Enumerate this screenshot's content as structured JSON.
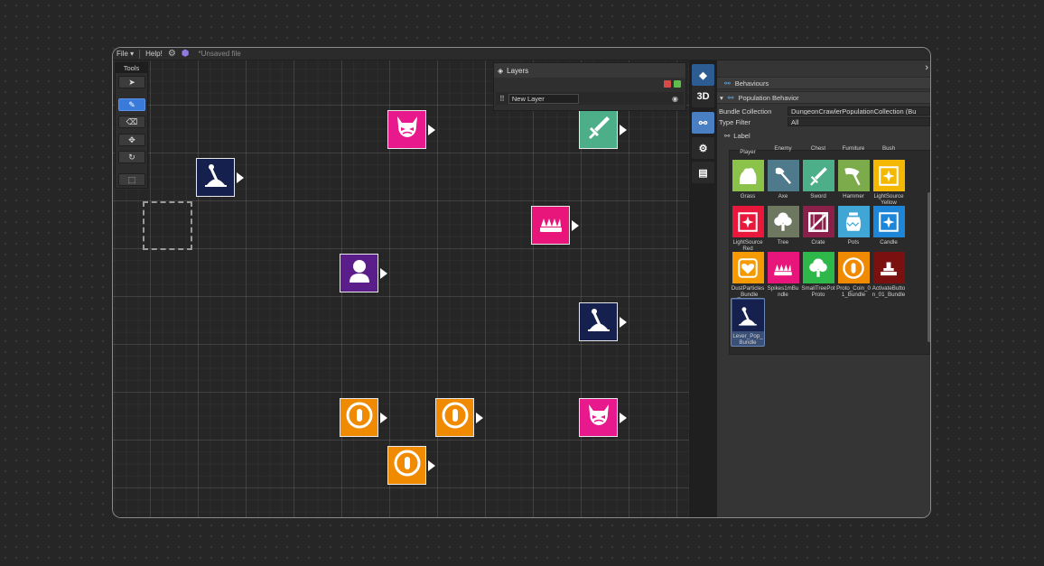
{
  "menu": {
    "file": "File ▾",
    "help": "Help!",
    "unsaved": "*Unsaved file"
  },
  "tools": {
    "title": "Tools"
  },
  "layers": {
    "title": "Layers",
    "layer_name": "New Layer"
  },
  "iconbar": {
    "label_3d": "3D"
  },
  "inspector": {
    "behaviours": "Behaviours",
    "population_behavior": "Population Behavior",
    "bundle_collection_label": "Bundle Collection",
    "bundle_collection_value": "DungeonCrawlerPopulationCollection (Bu",
    "type_filter_label": "Type Filter",
    "type_filter_value": "All",
    "label_header": "Label"
  },
  "palette": {
    "top_labels": [
      "Player",
      "Enemy",
      "Chest",
      "Furniture",
      "Bush"
    ],
    "items": [
      {
        "label": "Grass",
        "color": "#8bc34a",
        "icon": "grass-icon"
      },
      {
        "label": "Axe",
        "color": "#4f7a8c",
        "icon": "axe-icon"
      },
      {
        "label": "Sword",
        "color": "#4caf8a",
        "icon": "sword-icon"
      },
      {
        "label": "Hammer",
        "color": "#7cab4b",
        "icon": "hammer-icon"
      },
      {
        "label": "LightSource Yellow",
        "color": "#f5b800",
        "icon": "light-icon"
      },
      {
        "label": "LightSource Red",
        "color": "#e8173b",
        "icon": "light-icon"
      },
      {
        "label": "Tree",
        "color": "#6e7860",
        "icon": "tree-icon"
      },
      {
        "label": "Crate",
        "color": "#8a1f4a",
        "icon": "crate-icon"
      },
      {
        "label": "Pots",
        "color": "#3fa6d6",
        "icon": "pot-icon"
      },
      {
        "label": "Candle",
        "color": "#1e86d8",
        "icon": "light-icon"
      },
      {
        "label": "DustParticles_Bundle",
        "color": "#f59a00",
        "icon": "heart-icon"
      },
      {
        "label": "Spikes1mBundle",
        "color": "#e8167a",
        "icon": "spikes-icon"
      },
      {
        "label": "SmallTreePotProto",
        "color": "#2fb84a",
        "icon": "tree-icon"
      },
      {
        "label": "Proto_Coin_01_Bundle",
        "color": "#f08a00",
        "icon": "coin-icon"
      },
      {
        "label": "ActivateButton_01_Bundle",
        "color": "#7a1010",
        "icon": "button-icon"
      },
      {
        "label": "Lever_Pop_Bundle",
        "color": "#15204f",
        "icon": "lever-icon"
      }
    ]
  },
  "canvas_tiles": [
    {
      "name": "enemy-tile",
      "color": "#e8198c",
      "icon": "demon-icon"
    },
    {
      "name": "sword-tile",
      "color": "#4caf8a",
      "icon": "sword-icon"
    },
    {
      "name": "lever-tile",
      "color": "#15204f",
      "icon": "lever-icon"
    },
    {
      "name": "spikes-tile",
      "color": "#e8167a",
      "icon": "spikes-icon"
    },
    {
      "name": "player-tile",
      "color": "#5a1d8a",
      "icon": "player-icon"
    },
    {
      "name": "lever-tile",
      "color": "#15204f",
      "icon": "lever-icon"
    },
    {
      "name": "coin-tile",
      "color": "#f08a00",
      "icon": "coin-icon"
    },
    {
      "name": "coin-tile",
      "color": "#f08a00",
      "icon": "coin-icon"
    },
    {
      "name": "enemy-tile",
      "color": "#e8198c",
      "icon": "demon-icon"
    },
    {
      "name": "coin-tile",
      "color": "#f08a00",
      "icon": "coin-icon"
    }
  ]
}
